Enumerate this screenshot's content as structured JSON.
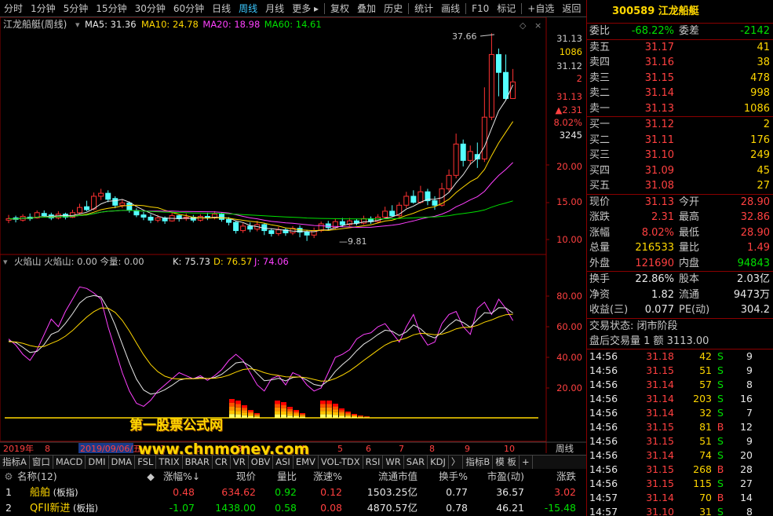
{
  "toolbar": {
    "items": [
      "分时",
      "1分钟",
      "5分钟",
      "15分钟",
      "30分钟",
      "60分钟",
      "日线",
      "周线",
      "月线",
      "更多 ▸",
      "复权",
      "叠加",
      "历史",
      "统计",
      "画线",
      "F10",
      "标记",
      "+自选",
      "返回"
    ],
    "active_index": 7
  },
  "main_chart": {
    "title": "江龙船艇(周线)",
    "ma_labels": [
      {
        "text": "MA5: 31.36",
        "color": "#e8e8e8"
      },
      {
        "text": "MA10: 24.78",
        "color": "#ffd700"
      },
      {
        "text": "MA20: 18.98",
        "color": "#ff40ff"
      },
      {
        "text": "MA60: 14.61",
        "color": "#00e000"
      }
    ],
    "high_label": "37.66",
    "low_label": "9.81",
    "axis_labels": [
      "31.13",
      "1086",
      "31.12",
      "2",
      "31.13",
      "▲2.31",
      "8.02%",
      "3245",
      "20.00",
      "15.00",
      "10.00"
    ]
  },
  "indicator": {
    "title": "火焰山  火焰山: 0.00  今量: 0.00",
    "kdj": [
      {
        "text": "K: 75.73",
        "color": "#e8e8e8"
      },
      {
        "text": "D: 76.57",
        "color": "#ffd700"
      },
      {
        "text": "J: 74.06",
        "color": "#ff40ff"
      }
    ],
    "axis_labels": [
      "80.00",
      "60.00",
      "40.00",
      "20.00"
    ]
  },
  "time_axis": {
    "labels": [
      "2019年",
      "8",
      "",
      "2019/09/06/五",
      "",
      "1",
      "2",
      "3",
      "4",
      "5",
      "6",
      "7",
      "8",
      "9",
      "10"
    ],
    "right_label": "周线"
  },
  "watermark": {
    "line1": "第一股票公式网",
    "line2": "www.chnmoney.com"
  },
  "indicator_tabs": [
    "指标A",
    "窗口",
    "MACD",
    "DMI",
    "DMA",
    "FSL",
    "TRIX",
    "BRAR",
    "CR",
    "VR",
    "OBV",
    "ASI",
    "EMV",
    "VOL-TDX",
    "RSI",
    "WR",
    "SAR",
    "KDJ",
    "〉",
    "指标B",
    "模 板",
    "+"
  ],
  "table": {
    "headers": [
      "名称(12)",
      "◆",
      "涨幅%↓",
      "现价",
      "量比",
      "涨速%",
      "流通市值",
      "换手%",
      "市盈(动)",
      "涨跌"
    ],
    "rows": [
      {
        "idx": "1",
        "name": "船舶",
        "tag": "(板指)",
        "chg": "0.48",
        "price": "634.62",
        "vr": "0.92",
        "spd": "0.12",
        "cap": "1503.25亿",
        "turn": "0.77",
        "pe": "36.57",
        "diff": "3.02",
        "up": true
      },
      {
        "idx": "2",
        "name": "QFII新进",
        "tag": "(板指)",
        "chg": "-1.07",
        "price": "1438.00",
        "vr": "0.58",
        "spd": "0.08",
        "cap": "4870.57亿",
        "turn": "0.78",
        "pe": "46.21",
        "diff": "-15.48",
        "up": false
      }
    ]
  },
  "quote": {
    "code_name": "300589 江龙船艇",
    "weibi": {
      "l1": "委比",
      "v1": "-68.22%",
      "l2": "委差",
      "v2": "-2142"
    },
    "sells": [
      {
        "label": "卖五",
        "price": "31.17",
        "vol": "41"
      },
      {
        "label": "卖四",
        "price": "31.16",
        "vol": "38"
      },
      {
        "label": "卖三",
        "price": "31.15",
        "vol": "478"
      },
      {
        "label": "卖二",
        "price": "31.14",
        "vol": "998"
      },
      {
        "label": "卖一",
        "price": "31.13",
        "vol": "1086"
      }
    ],
    "buys": [
      {
        "label": "买一",
        "price": "31.12",
        "vol": "2"
      },
      {
        "label": "买二",
        "price": "31.11",
        "vol": "176"
      },
      {
        "label": "买三",
        "price": "31.10",
        "vol": "249"
      },
      {
        "label": "买四",
        "price": "31.09",
        "vol": "45"
      },
      {
        "label": "买五",
        "price": "31.08",
        "vol": "27"
      }
    ],
    "stats": [
      {
        "l1": "现价",
        "v1": "31.13",
        "c1": "red",
        "l2": "今开",
        "v2": "28.90",
        "c2": "red"
      },
      {
        "l1": "涨跌",
        "v1": "2.31",
        "c1": "red",
        "l2": "最高",
        "v2": "32.86",
        "c2": "red"
      },
      {
        "l1": "涨幅",
        "v1": "8.02%",
        "c1": "red",
        "l2": "最低",
        "v2": "28.90",
        "c2": "red"
      },
      {
        "l1": "总量",
        "v1": "216533",
        "c1": "yellow",
        "l2": "量比",
        "v2": "1.49",
        "c2": "red"
      },
      {
        "l1": "外盘",
        "v1": "121690",
        "c1": "red",
        "l2": "内盘",
        "v2": "94843",
        "c2": "green"
      }
    ],
    "stats2": [
      {
        "l1": "换手",
        "v1": "22.86%",
        "l2": "股本",
        "v2": "2.03亿"
      },
      {
        "l1": "净资",
        "v1": "1.82",
        "l2": "流通",
        "v2": "9473万"
      },
      {
        "l1": "收益(三)",
        "v1": "0.077",
        "l2": "PE(动)",
        "v2": "304.2"
      }
    ],
    "status1": "交易状态: 闭市阶段",
    "status2": "盘后交易量 1 额 3113.00",
    "ticks": [
      {
        "t": "14:56",
        "p": "31.18",
        "v": "42",
        "s": "S",
        "n": "9"
      },
      {
        "t": "14:56",
        "p": "31.15",
        "v": "51",
        "s": "S",
        "n": "9"
      },
      {
        "t": "14:56",
        "p": "31.14",
        "v": "57",
        "s": "S",
        "n": "8"
      },
      {
        "t": "14:56",
        "p": "31.14",
        "v": "203",
        "s": "S",
        "n": "16"
      },
      {
        "t": "14:56",
        "p": "31.14",
        "v": "32",
        "s": "S",
        "n": "7"
      },
      {
        "t": "14:56",
        "p": "31.15",
        "v": "81",
        "s": "B",
        "n": "12"
      },
      {
        "t": "14:56",
        "p": "31.15",
        "v": "51",
        "s": "S",
        "n": "9"
      },
      {
        "t": "14:56",
        "p": "31.14",
        "v": "74",
        "s": "S",
        "n": "20"
      },
      {
        "t": "14:56",
        "p": "31.15",
        "v": "268",
        "s": "B",
        "n": "28"
      },
      {
        "t": "14:56",
        "p": "31.15",
        "v": "115",
        "s": "S",
        "n": "27"
      },
      {
        "t": "14:57",
        "p": "31.14",
        "v": "70",
        "s": "B",
        "n": "14"
      },
      {
        "t": "14:57",
        "p": "31.10",
        "v": "31",
        "s": "S",
        "n": "8"
      }
    ]
  }
}
